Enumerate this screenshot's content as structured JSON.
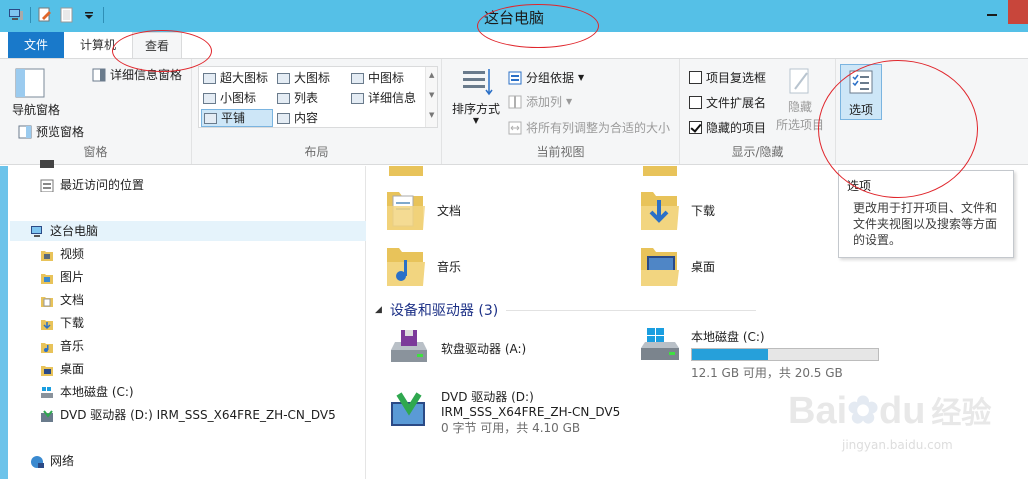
{
  "window": {
    "title": "这台电脑"
  },
  "tabs": {
    "file": "文件",
    "computer": "计算机",
    "view": "查看"
  },
  "ribbon": {
    "pane": {
      "nav_pane": "导航窗格",
      "preview_pane": "预览窗格",
      "details_pane": "详细信息窗格",
      "group_label": "窗格"
    },
    "layout": {
      "items": [
        "超大图标",
        "大图标",
        "中图标",
        "小图标",
        "列表",
        "详细信息",
        "平铺",
        "内容"
      ],
      "selected": "平铺",
      "group_label": "布局"
    },
    "current_view": {
      "sort_by": "排序方式",
      "group_by": "分组依据",
      "add_columns": "添加列",
      "size_all_columns": "将所有列调整为合适的大小",
      "group_label": "当前视图"
    },
    "show_hide": {
      "item_checkboxes": "项目复选框",
      "file_extensions": "文件扩展名",
      "hidden_items": "隐藏的项目",
      "item_checkboxes_checked": false,
      "file_extensions_checked": false,
      "hidden_items_checked": true,
      "hide_selected_1": "隐藏",
      "hide_selected_2": "所选项目",
      "group_label": "显示/隐藏"
    },
    "options": {
      "label": "选项"
    }
  },
  "tooltip": {
    "title": "选项",
    "description": "更改用于打开项目、文件和文件夹视图以及搜索等方面的设置。"
  },
  "nav": {
    "recent": "最近访问的位置",
    "this_pc": "这台电脑",
    "videos": "视频",
    "pictures": "图片",
    "documents": "文档",
    "downloads": "下载",
    "music": "音乐",
    "desktop": "桌面",
    "local_disk": "本地磁盘 (C:)",
    "dvd_drive": "DVD 驱动器 (D:) IRM_SSS_X64FRE_ZH-CN_DV5",
    "network": "网络"
  },
  "content": {
    "folders": {
      "documents": "文档",
      "downloads": "下载",
      "music": "音乐",
      "desktop": "桌面"
    },
    "devices_header": "设备和驱动器 (3)",
    "floppy": "软盘驱动器 (A:)",
    "local_disk": {
      "name": "本地磁盘 (C:)",
      "info": "12.1 GB 可用，共 20.5 GB",
      "used_fraction": 0.41
    },
    "dvd": {
      "name": "DVD 驱动器 (D:)",
      "label": "IRM_SSS_X64FRE_ZH-CN_DV5",
      "info": "0 字节 可用，共 4.10 GB"
    }
  },
  "watermark": {
    "text1": "Bai",
    "text2": "du",
    "text3": "经验",
    "url": "jingyan.baidu.com"
  },
  "colors": {
    "titlebar": "#55c0e7",
    "file_tab": "#1979ca",
    "annotation": "#e0262c",
    "disk_bar": "#26a0da"
  }
}
